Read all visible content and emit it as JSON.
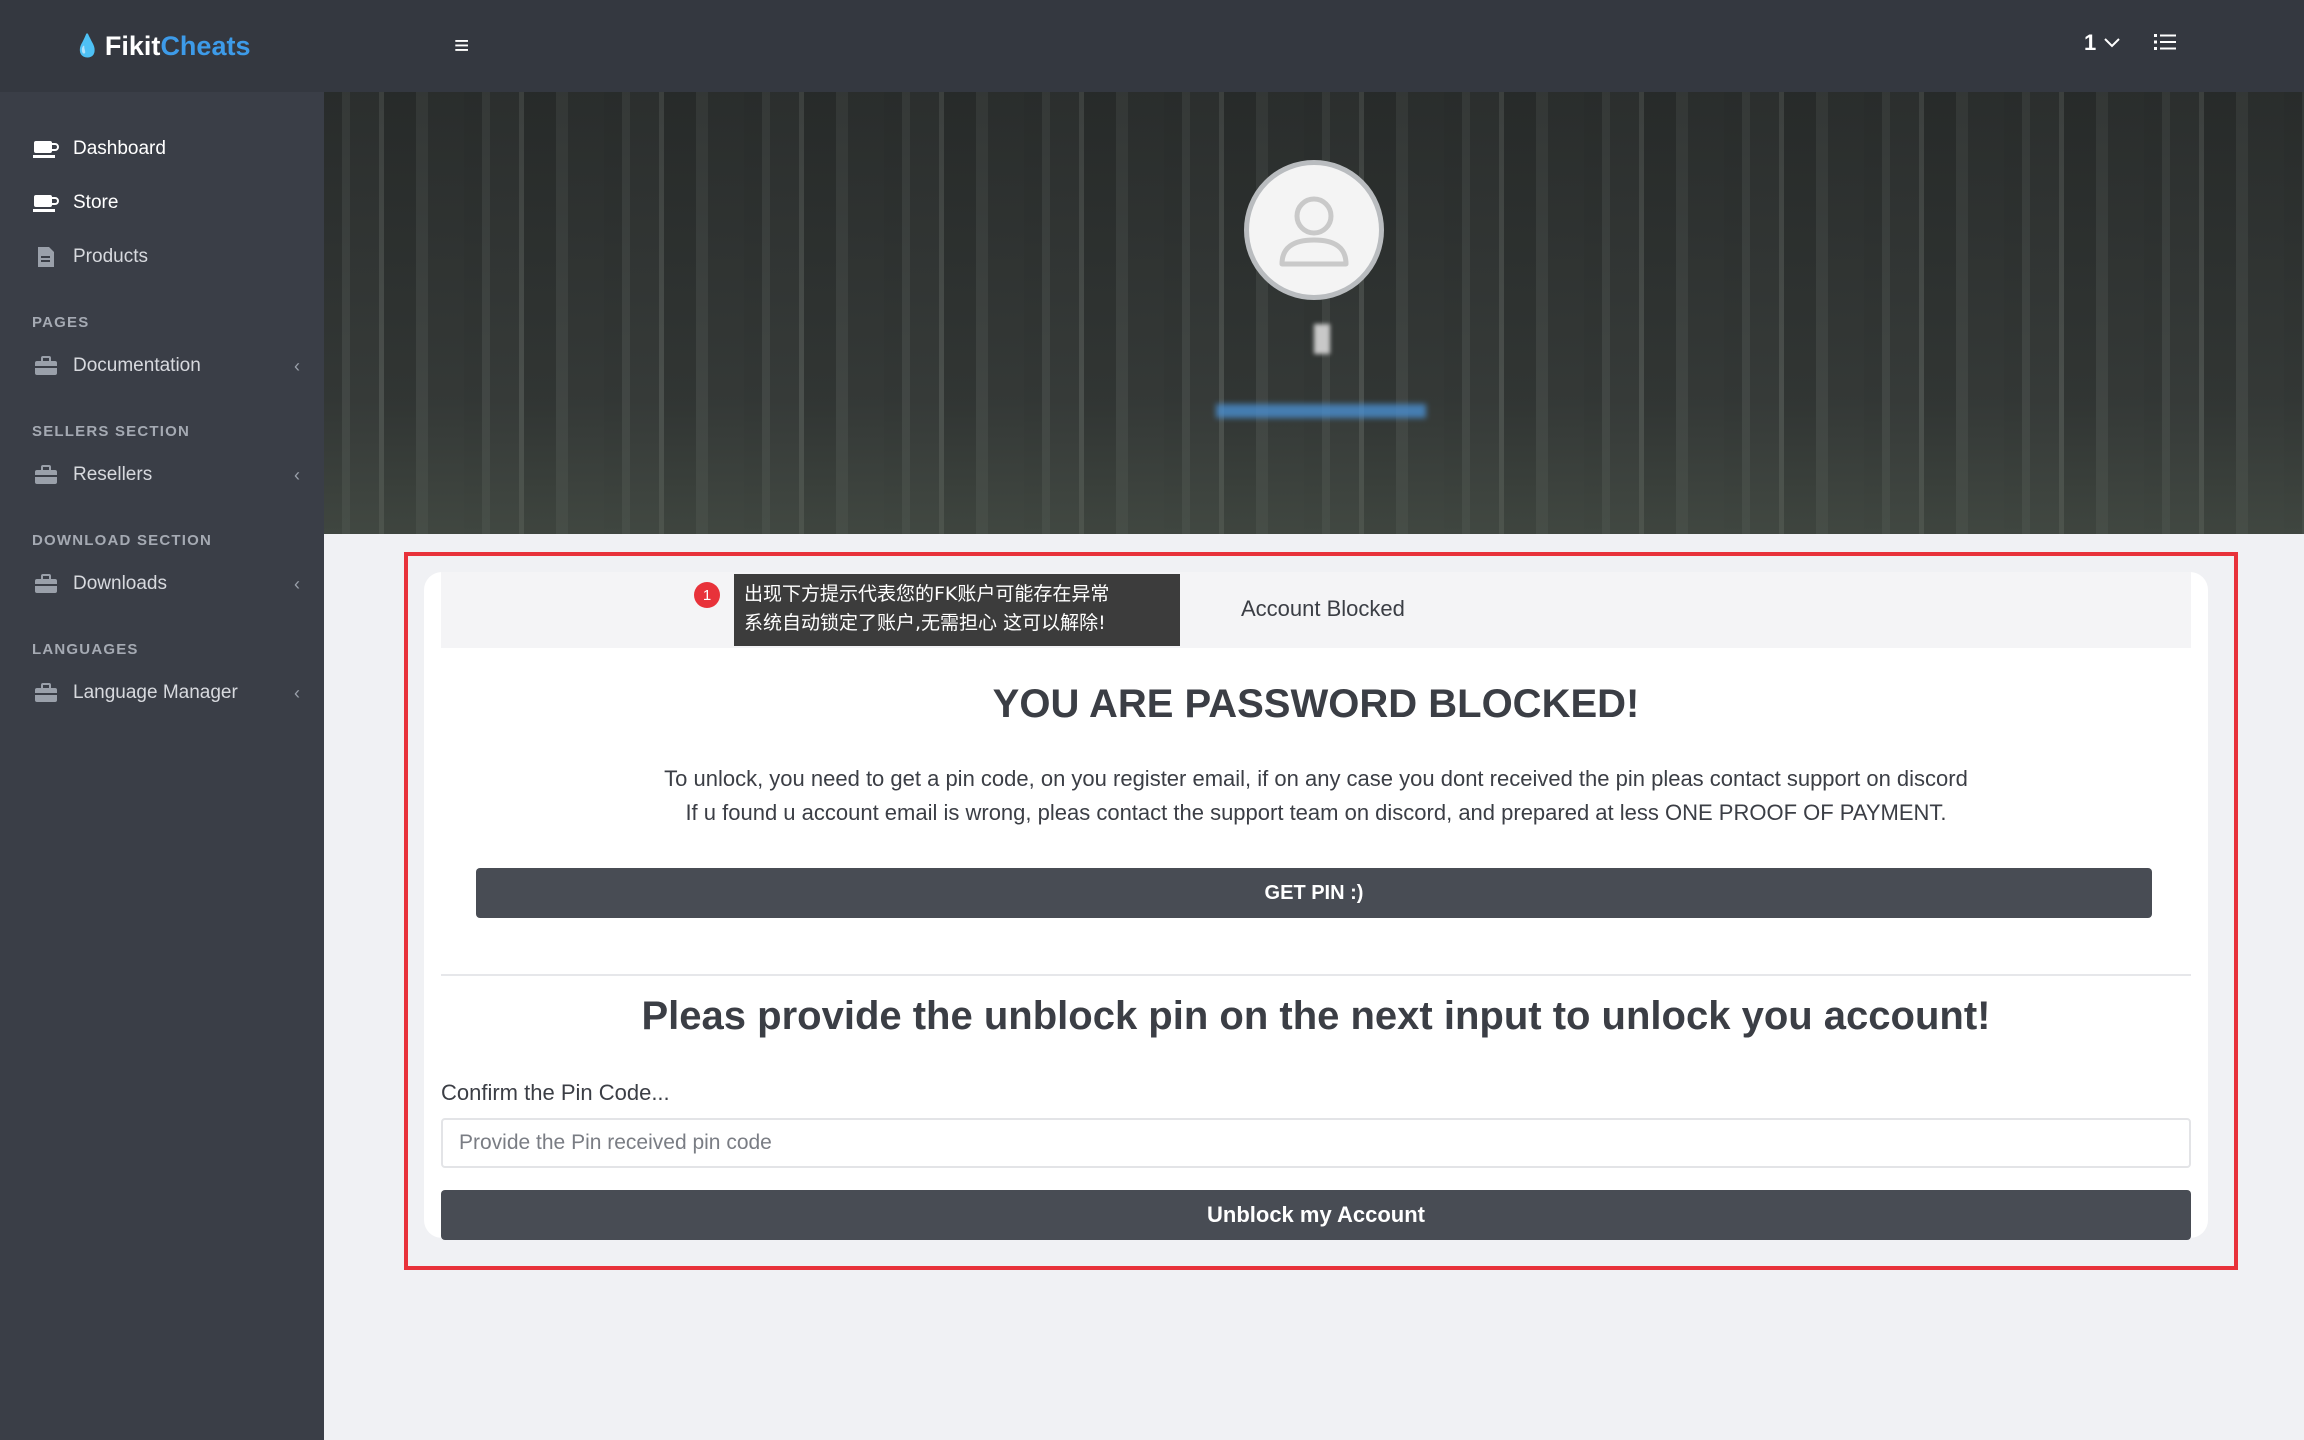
{
  "brand": {
    "part1": "Fikit",
    "part2": "Cheats",
    "logo_icon": "flame-icon"
  },
  "sidebar": {
    "items_top": [
      {
        "label": "Dashboard",
        "icon": "cup-icon"
      },
      {
        "label": "Store",
        "icon": "cup-icon"
      },
      {
        "label": "Products",
        "icon": "file-icon"
      }
    ],
    "sections": [
      {
        "title": "PAGES",
        "item": {
          "label": "Documentation",
          "icon": "briefcase-icon"
        }
      },
      {
        "title": "SELLERS SECTION",
        "item": {
          "label": "Resellers",
          "icon": "briefcase-icon"
        }
      },
      {
        "title": "DOWNLOAD SECTION",
        "item": {
          "label": "Downloads",
          "icon": "briefcase-icon"
        }
      },
      {
        "title": "LANGUAGES",
        "item": {
          "label": "Language Manager",
          "icon": "briefcase-icon"
        }
      }
    ],
    "chevron": "‹"
  },
  "topbar": {
    "menu_icon": "≡",
    "user_label": "1",
    "user_caret": "⌵"
  },
  "annotation": {
    "badge": "1",
    "line1": "出现下方提示代表您的FK账户可能存在异常",
    "line2": "系统自动锁定了账户,无需担心 这可以解除!"
  },
  "card": {
    "header_title": "Account Blocked",
    "blocked_title": "YOU ARE PASSWORD BLOCKED!",
    "info_line1": "To unlock, you need to get a pin code, on you register email, if on any case you dont received the pin pleas contact support on discord",
    "info_line2": "If u found u account email is wrong, pleas contact the support team on discord, and prepared at less ONE PROOF OF PAYMENT.",
    "get_pin_label": "GET PIN :)",
    "provide_title": "Pleas provide the unblock pin on the next input to unlock you account!",
    "pin_label": "Confirm the Pin Code...",
    "pin_placeholder": "Provide the Pin received pin code",
    "pin_value": "",
    "unblock_label": "Unblock my Account"
  }
}
